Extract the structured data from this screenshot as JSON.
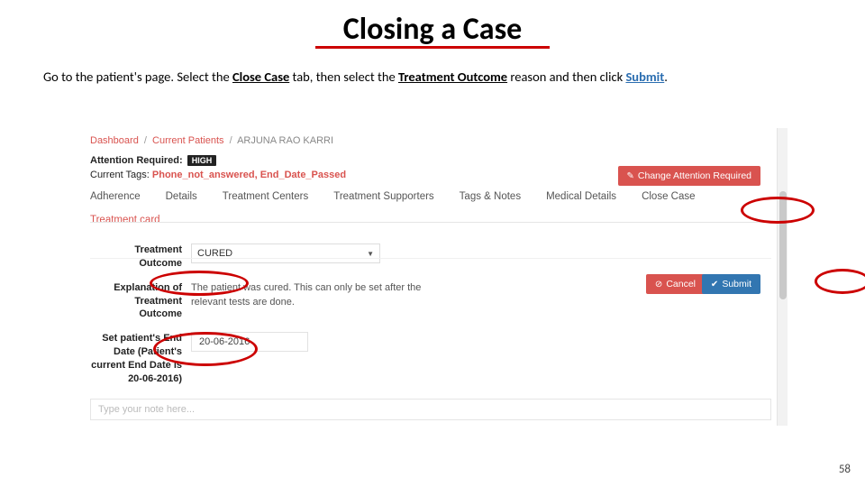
{
  "slide": {
    "title": "Closing a Case",
    "instruction_parts": {
      "p1": "Go to the patient's page. Select the ",
      "close_case": "Close Case",
      "p2": " tab, then select the ",
      "treatment_outcome": "Treatment Outcome",
      "p3": " reason and then click ",
      "submit": "Submit",
      "p4": "."
    },
    "page_number": "58"
  },
  "breadcrumb": {
    "dashboard": "Dashboard",
    "current_patients": "Current Patients",
    "patient_name": "ARJUNA RAO KARRI"
  },
  "attention": {
    "label": "Attention Required:",
    "badge": "HIGH"
  },
  "current_tags": {
    "label": "Current Tags: ",
    "value": "Phone_not_answered, End_Date_Passed"
  },
  "buttons": {
    "change_attention": "Change Attention Required",
    "cancel": "Cancel",
    "submit": "Submit"
  },
  "tabs": {
    "adherence": "Adherence",
    "details": "Details",
    "treatment_centers": "Treatment Centers",
    "treatment_supporters": "Treatment Supporters",
    "tags_notes": "Tags & Notes",
    "medical_details": "Medical Details",
    "close_case": "Close Case"
  },
  "subtab": {
    "treatment_card": "Treatment card"
  },
  "form": {
    "outcome_label": "Treatment Outcome",
    "outcome_value": "CURED",
    "explain_label": "Explanation of Treatment Outcome",
    "explain_text": "The patient was cured. This can only be set after the relevant tests are done.",
    "enddate_label": "Set patient's End Date (Patient's current End Date is 20-06-2016)",
    "enddate_value": "20-06-2016"
  },
  "note": {
    "placeholder": "Type your note here..."
  }
}
